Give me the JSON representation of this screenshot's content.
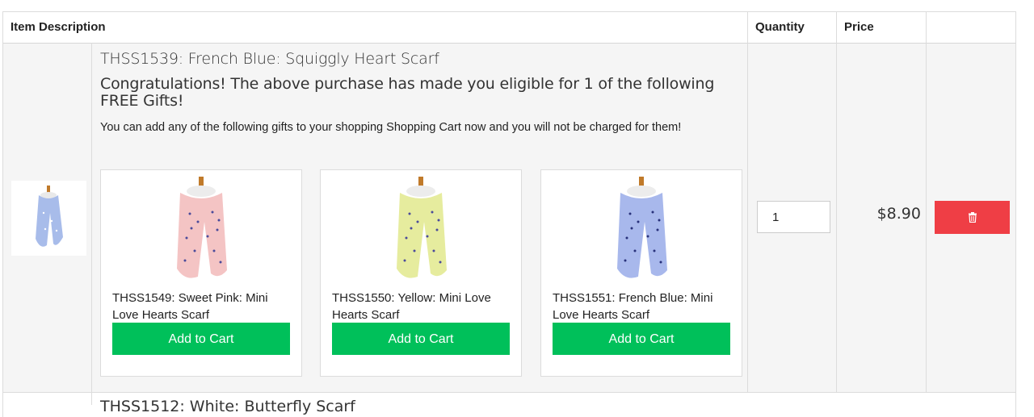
{
  "table": {
    "headers": {
      "description": "Item Description",
      "quantity": "Quantity",
      "price": "Price"
    }
  },
  "item": {
    "title": "THSS1539: French Blue: Squiggly Heart Scarf",
    "congrats": "Congratulations! The above purchase has made you eligible for 1 of the following FREE Gifts!",
    "note": "You can add any of the following gifts to your shopping Shopping Cart now and you will not be charged for them!",
    "quantity": "1",
    "price": "$8.90",
    "thumb_icon": "scarf-thumbnail",
    "delete_icon": "trash-icon"
  },
  "gifts": [
    {
      "name": "THSS1549: Sweet Pink: Mini Love Hearts Scarf",
      "button": "Add to Cart",
      "color": "#f4c4c4"
    },
    {
      "name": "THSS1550: Yellow: Mini Love Hearts Scarf",
      "button": "Add to Cart",
      "color": "#e6ec9e"
    },
    {
      "name": "THSS1551: French Blue: Mini Love Hearts Scarf",
      "button": "Add to Cart",
      "color": "#a8b8ec"
    }
  ],
  "next_item": {
    "title": "THSS1512: White: Butterfly Scarf"
  },
  "colors": {
    "add_button": "#00c05a",
    "delete_button": "#ef3e45",
    "row_bg": "#f5f5f5"
  }
}
